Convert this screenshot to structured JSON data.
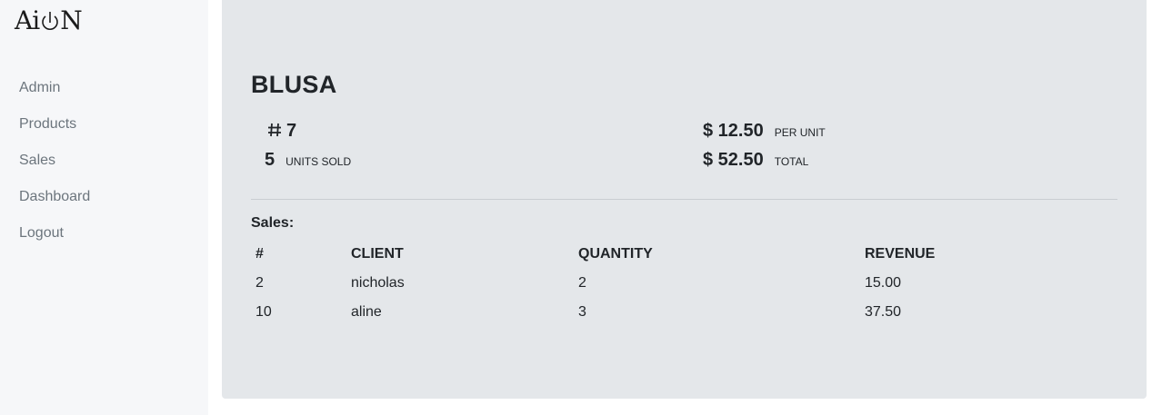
{
  "sidebar": {
    "logo_left": "Ai",
    "logo_right": "N",
    "items": [
      {
        "label": "Admin"
      },
      {
        "label": "Products"
      },
      {
        "label": "Sales"
      },
      {
        "label": "Dashboard"
      },
      {
        "label": "Logout"
      }
    ]
  },
  "product": {
    "name": "BLUSA",
    "id": "7",
    "units_sold": "5",
    "units_sold_label": "UNITS SOLD",
    "price": "$ 12.50",
    "price_label": "PER UNIT",
    "total": "$ 52.50",
    "total_label": "TOTAL"
  },
  "sales": {
    "label": "Sales:",
    "columns": [
      "#",
      "CLIENT",
      "QUANTITY",
      "REVENUE"
    ],
    "rows": [
      {
        "id": "2",
        "client": "nicholas",
        "quantity": "2",
        "revenue": "15.00"
      },
      {
        "id": "10",
        "client": "aline",
        "quantity": "3",
        "revenue": "37.50"
      }
    ]
  }
}
